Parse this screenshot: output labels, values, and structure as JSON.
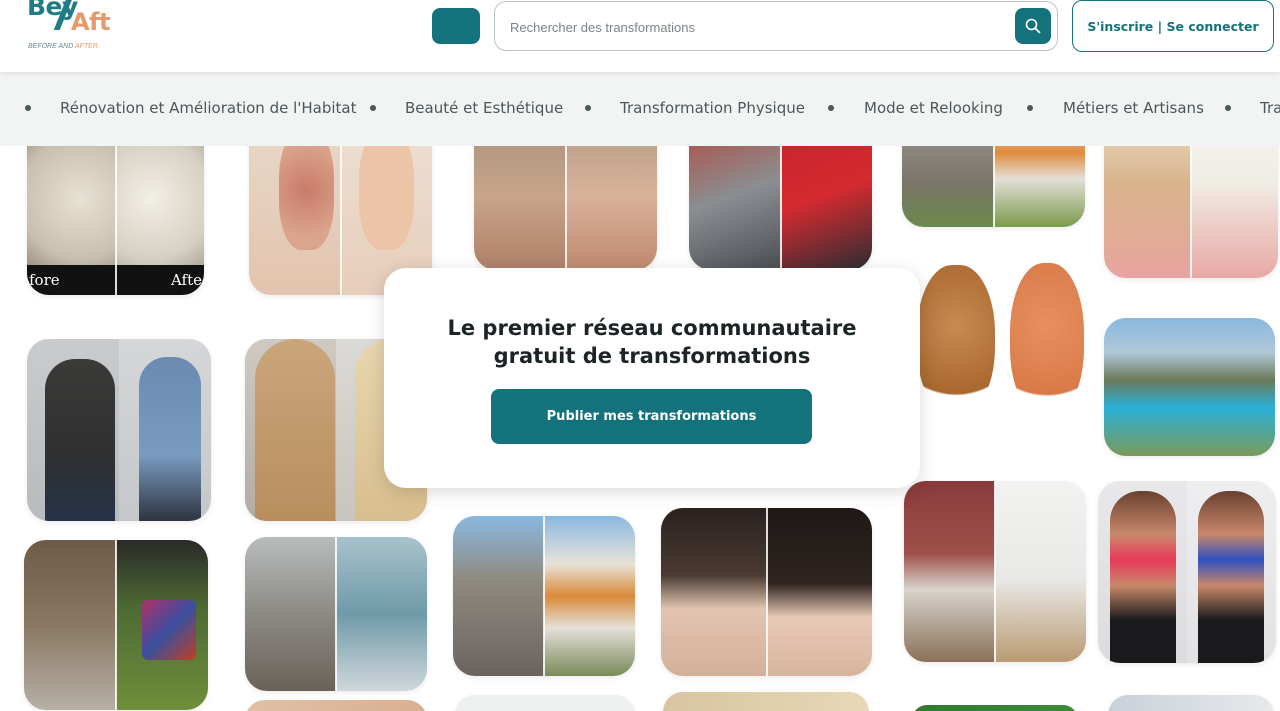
{
  "brand": {
    "logo_part1": "Bey",
    "logo_part2": "Aft",
    "tagline_part1": "BEFORE AND ",
    "tagline_part2": "AFTER",
    "colors": {
      "primary": "#14727c",
      "accent": "#e49a6b"
    }
  },
  "header": {
    "menu_icon": "menu-icon",
    "search_placeholder": "Rechercher des transformations",
    "search_icon": "search-icon",
    "login_label": "S'inscrire | Se connecter"
  },
  "categories": [
    "Rénovation et Amélioration de l'Habitat",
    "Beauté et Esthétique",
    "Transformation Physique",
    "Mode et Relooking",
    "Métiers et Artisans",
    "Tra"
  ],
  "hero": {
    "title": "Le premier réseau communautaire gratuit de transformations",
    "cta_label": "Publier mes transformations"
  },
  "tiles": [
    {
      "name": "watch-restoration",
      "labels": [
        "fore",
        "Afte"
      ]
    },
    {
      "name": "acne-skin-treatment"
    },
    {
      "name": "face-skin-rejuvenation"
    },
    {
      "name": "car-repair"
    },
    {
      "name": "house-construction"
    },
    {
      "name": "teeth-whitening"
    },
    {
      "name": "dog-grooming"
    },
    {
      "name": "weight-loss-men"
    },
    {
      "name": "hair-transformation"
    },
    {
      "name": "pool-garden"
    },
    {
      "name": "chair-upholstery"
    },
    {
      "name": "bathroom-renovation"
    },
    {
      "name": "facade-renovation"
    },
    {
      "name": "hairline-restoration"
    },
    {
      "name": "room-renovation"
    },
    {
      "name": "fitness-women"
    }
  ]
}
